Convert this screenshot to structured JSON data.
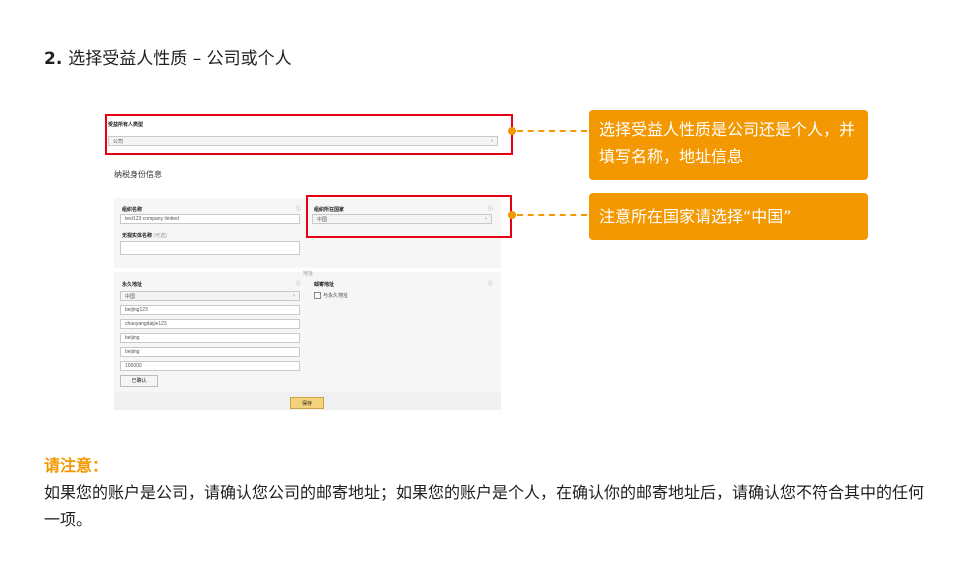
{
  "step": {
    "number": "2.",
    "title": "选择受益人性质 – 公司或个人"
  },
  "form": {
    "type_label": "受益所有人类型",
    "type_value": "公司",
    "section_title": "纳税身份信息",
    "org_name_label": "组织名称",
    "org_name_value": "test123 company limited",
    "disregarded_label": "无视实体名称",
    "disregarded_optional": "(可选)",
    "country_label": "组织所在国家",
    "country_value": "中国",
    "address_divider": "地址",
    "perm_address_label": "永久地址",
    "perm_country": "中国",
    "addr_lines": [
      "beijing123",
      "chaoyangdaijie123",
      "beijing",
      "beijing",
      "100000"
    ],
    "not_confirmed_button": "已确认",
    "mail_address_label": "邮寄地址",
    "same_as_perm": "与永久地址",
    "save_button": "保存"
  },
  "callouts": {
    "type": "选择受益人性质是公司还是个人，并填写名称，地址信息",
    "country": "注意所在国家请选择“中国”"
  },
  "note": {
    "title": "请注意：",
    "body": "如果您的账户是公司，请确认您公司的邮寄地址；如果您的账户是个人，在确认你的邮寄地址后，请确认您不符合其中的任何一项。"
  },
  "colors": {
    "accent": "#f39800",
    "highlight": "#e60012"
  }
}
